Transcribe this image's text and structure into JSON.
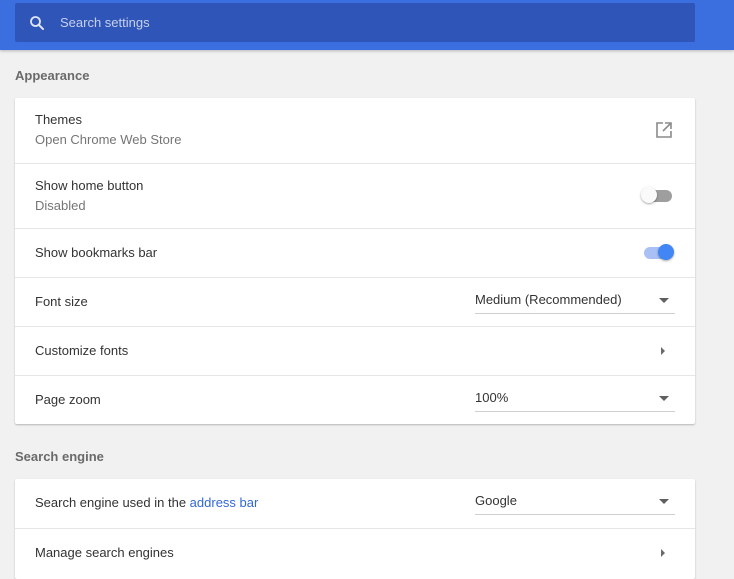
{
  "search": {
    "placeholder": "Search settings",
    "icon": "search-icon"
  },
  "appearance": {
    "title": "Appearance",
    "themes": {
      "label": "Themes",
      "sublabel": "Open Chrome Web Store",
      "icon": "open-in-new-icon"
    },
    "home_button": {
      "label": "Show home button",
      "sublabel": "Disabled",
      "enabled": false
    },
    "bookmarks_bar": {
      "label": "Show bookmarks bar",
      "enabled": true
    },
    "font_size": {
      "label": "Font size",
      "value": "Medium (Recommended)"
    },
    "customize_fonts": {
      "label": "Customize fonts"
    },
    "page_zoom": {
      "label": "Page zoom",
      "value": "100%"
    }
  },
  "search_engine": {
    "title": "Search engine",
    "used_in": {
      "label_prefix": "Search engine used in the ",
      "label_link": "address bar",
      "value": "Google"
    },
    "manage": {
      "label": "Manage search engines"
    }
  },
  "colors": {
    "topbar": "#3b6fe0",
    "searchbox": "#2f55b8",
    "accent": "#4285f4",
    "link": "#3367d6"
  }
}
